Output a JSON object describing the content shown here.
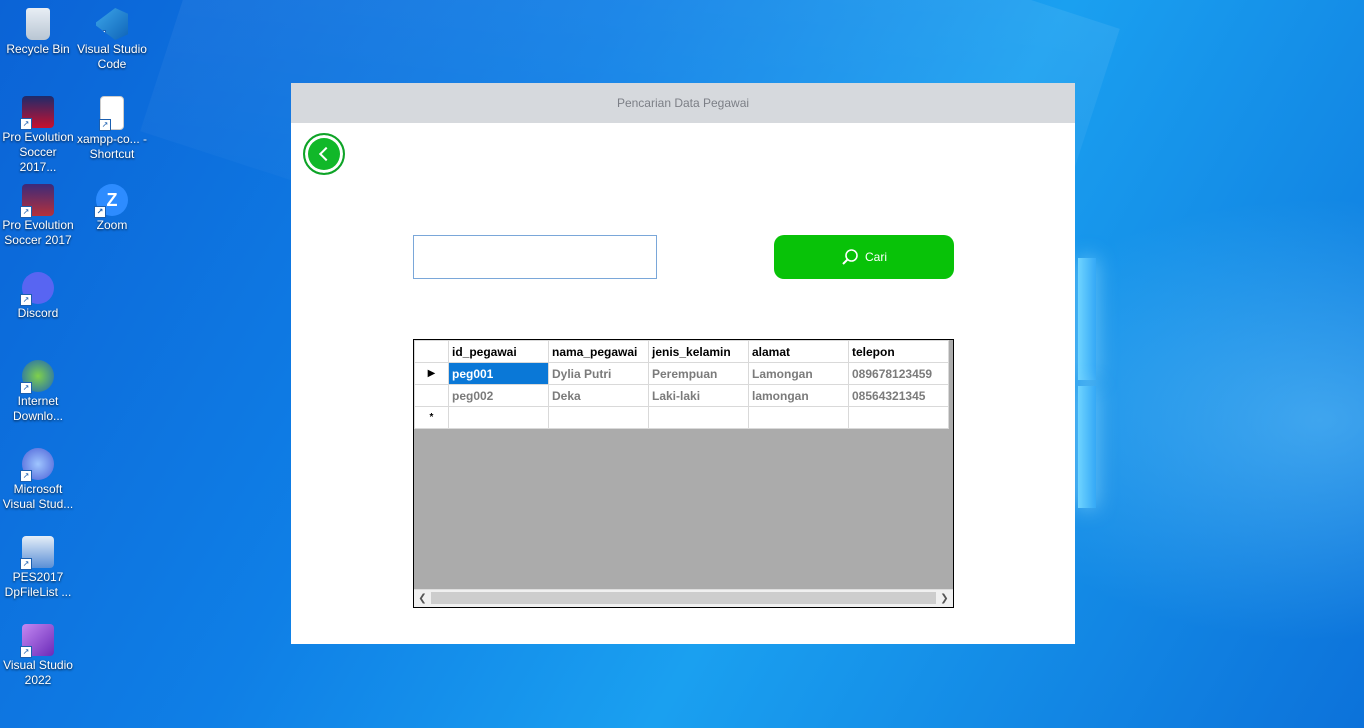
{
  "desktop": {
    "icons": [
      {
        "label": "Recycle Bin"
      },
      {
        "label": "Visual Studio Code"
      },
      {
        "label": "Pro Evolution Soccer 2017..."
      },
      {
        "label": "xampp-co... - Shortcut"
      },
      {
        "label": "Pro Evolution Soccer 2017"
      },
      {
        "label": "Zoom"
      },
      {
        "label": "Discord"
      },
      {
        "label": "Internet Downlo..."
      },
      {
        "label": "Microsoft Visual Stud..."
      },
      {
        "label": "PES2017 DpFileList ..."
      },
      {
        "label": "Visual Studio 2022"
      }
    ]
  },
  "app": {
    "title": "Pencarian Data Pegawai",
    "search": {
      "value": "",
      "placeholder": ""
    },
    "search_button_label": "Cari",
    "grid": {
      "columns": [
        "id_pegawai",
        "nama_pegawai",
        "jenis_kelamin",
        "alamat",
        "telepon"
      ],
      "rows": [
        [
          "peg001",
          "Dylia Putri",
          "Perempuan",
          "Lamongan",
          "089678123459"
        ],
        [
          "peg002",
          "Deka",
          "Laki-laki",
          "lamongan",
          "08564321345"
        ]
      ],
      "current_row_marker": "▶",
      "new_row_marker": "*",
      "selected_cell": "peg001"
    }
  },
  "colors": {
    "accent_green": "#08c208",
    "selection_blue": "#0a78d7",
    "grid_empty_bg": "#ababab"
  }
}
